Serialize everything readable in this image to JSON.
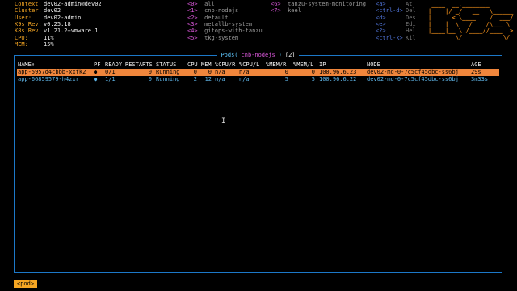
{
  "header": {
    "info": [
      {
        "label": "Context:",
        "value": "dev02-admin@dev02"
      },
      {
        "label": "Cluster:",
        "value": "dev02"
      },
      {
        "label": "User:",
        "value": "dev02-admin"
      },
      {
        "label": "K9s Rev:",
        "value": "v0.25.18"
      },
      {
        "label": "K8s Rev:",
        "value": "v1.21.2+vmware.1"
      },
      {
        "label": "CPU:",
        "value": "11%"
      },
      {
        "label": "MEM:",
        "value": "15%"
      }
    ],
    "namespaces_col1": [
      {
        "key": "<0>",
        "name": "all"
      },
      {
        "key": "<1>",
        "name": "cnb-nodejs"
      },
      {
        "key": "<2>",
        "name": "default"
      },
      {
        "key": "<3>",
        "name": "metallb-system"
      },
      {
        "key": "<4>",
        "name": "gitops-with-tanzu"
      },
      {
        "key": "<5>",
        "name": "tkg-system"
      }
    ],
    "namespaces_col2": [
      {
        "key": "<6>",
        "name": "tanzu-system-monitoring"
      },
      {
        "key": "<7>",
        "name": "keel"
      }
    ],
    "hints": [
      {
        "key": "<a>",
        "desc": "At"
      },
      {
        "key": "<ctrl-d>",
        "desc": "Del"
      },
      {
        "key": "<d>",
        "desc": "Des"
      },
      {
        "key": "<e>",
        "desc": "Edi"
      },
      {
        "key": "<?>",
        "desc": "Hel"
      },
      {
        "key": "<ctrl-k>",
        "desc": "Kil"
      }
    ]
  },
  "table": {
    "title_main": " Pods(",
    "title_ns": "cnb-nodejs",
    "title_close": ")",
    "title_count": "[2]",
    "columns": [
      "NAME↑",
      "PF",
      "READY",
      "RESTARTS",
      "STATUS",
      "CPU",
      "MEM",
      "%CPU/R",
      "%CPU/L",
      "%MEM/R",
      "%MEM/L",
      "IP",
      "NODE",
      "AGE"
    ],
    "rows": [
      {
        "name": "app-5957d4cbbb-xxfk2",
        "pf": "●",
        "ready": "0/1",
        "restarts": "0",
        "status": "Running",
        "cpu": "0",
        "mem": "0",
        "cpu_r": "n/a",
        "cpu_l": "n/a",
        "mem_r": "0",
        "mem_l": "0",
        "ip": "100.96.6.23",
        "node": "dev02-md-0-7c5cf45dbc-ss6bj",
        "age": "29s",
        "selected": true
      },
      {
        "name": "app-66859579-h4zxr",
        "pf": "●",
        "ready": "1/1",
        "restarts": "0",
        "status": "Running",
        "cpu": "2",
        "mem": "12",
        "cpu_r": "n/a",
        "cpu_l": "n/a",
        "mem_r": "5",
        "mem_l": "5",
        "ip": "100.96.6.22",
        "node": "dev02-md-0-7c5cf45dbc-ss6bj",
        "age": "3m33s",
        "selected": false
      }
    ]
  },
  "breadcrumb": "<pod>",
  "colors": {
    "selected_row": "#f0863c",
    "border": "#1c78c8",
    "label": "#f5a623",
    "namespace_key": "#d957d9",
    "row_text": "#5fb4e6"
  }
}
